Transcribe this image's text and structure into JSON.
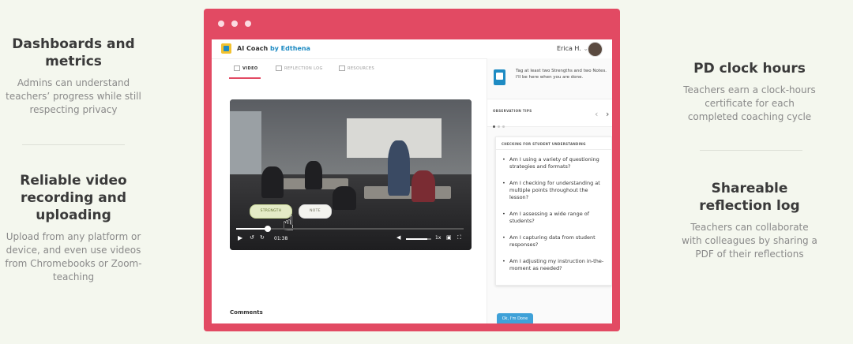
{
  "features": {
    "left": [
      {
        "title": "Dashboards and metrics",
        "desc": "Admins can understand teachers’ progress while still respecting privacy"
      },
      {
        "title": "Reliable video recording and uploading",
        "desc": "Upload from any platform or device, and even use videos from Chromebooks or Zoom-teaching"
      }
    ],
    "right": [
      {
        "title": "PD clock hours",
        "desc": "Teachers earn a clock-hours certificate for each completed coaching cycle"
      },
      {
        "title": "Shareable reflection log",
        "desc": "Teachers can collaborate with colleagues by sharing a PDF of their reflections"
      }
    ]
  },
  "app": {
    "brand": "AI Coach",
    "brand_by": "by Edthena",
    "user_name": "Erica H.",
    "user_chevron": "⌄",
    "tabs": [
      {
        "label": "VIDEO",
        "active": true
      },
      {
        "label": "REFLECTION LOG",
        "active": false
      },
      {
        "label": "RESOURCES",
        "active": false
      }
    ],
    "video": {
      "chip_strength": "STRENGTH",
      "chip_note": "NOTE",
      "time": "01:38",
      "speed": "1x",
      "progress": 0.14,
      "volume": 0.85
    },
    "comments_label": "Comments",
    "coach": {
      "prompt": "Tag at least two Strengths and two Notes. I'll be here when you are done.",
      "tips_label": "OBSERVATION TIPS",
      "card_title": "CHECKING FOR STUDENT UNDERSTANDING",
      "questions": [
        "Am I using a variety of questioning strategies and formats?",
        "Am I checking for understanding at multiple points throughout the lesson?",
        "Am I assessing a wide range of students?",
        "Am I capturing data from student responses?",
        "Am I adjusting my instruction in-the-moment as needed?"
      ],
      "done_label": "Ok, I'm Done"
    }
  },
  "colors": {
    "frame": "#e24a63",
    "accent_blue": "#1e8bc3",
    "background": "#f4f7ee"
  }
}
